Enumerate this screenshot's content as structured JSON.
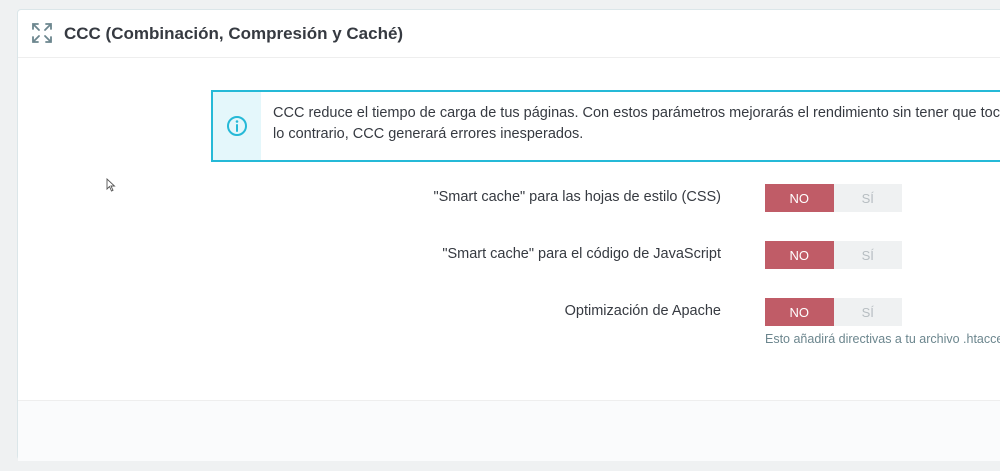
{
  "panel": {
    "title": "CCC (Combinación, Compresión y Caché)",
    "heading_icon": "expand-icon"
  },
  "alert": {
    "icon": "info-icon",
    "line1": "CCC reduce el tiempo de carga de tus páginas. Con estos parámetros mejorarás el rendimiento sin tener que tocar",
    "line2": "lo contrario, CCC generará errores inesperados."
  },
  "settings": [
    {
      "label": "\"Smart cache\" para las hojas de estilo (CSS)",
      "no": "NO",
      "yes": "SÍ",
      "selected": "NO"
    },
    {
      "label": "\"Smart cache\" para el código de JavaScript",
      "no": "NO",
      "yes": "SÍ",
      "selected": "NO"
    },
    {
      "label": "Optimización de Apache",
      "no": "NO",
      "yes": "SÍ",
      "selected": "NO"
    }
  ],
  "apache_help": "Esto añadirá directivas a tu archivo .htaccess",
  "colors": {
    "accent": "#25b9d7",
    "switch_off": "#c05c67"
  }
}
